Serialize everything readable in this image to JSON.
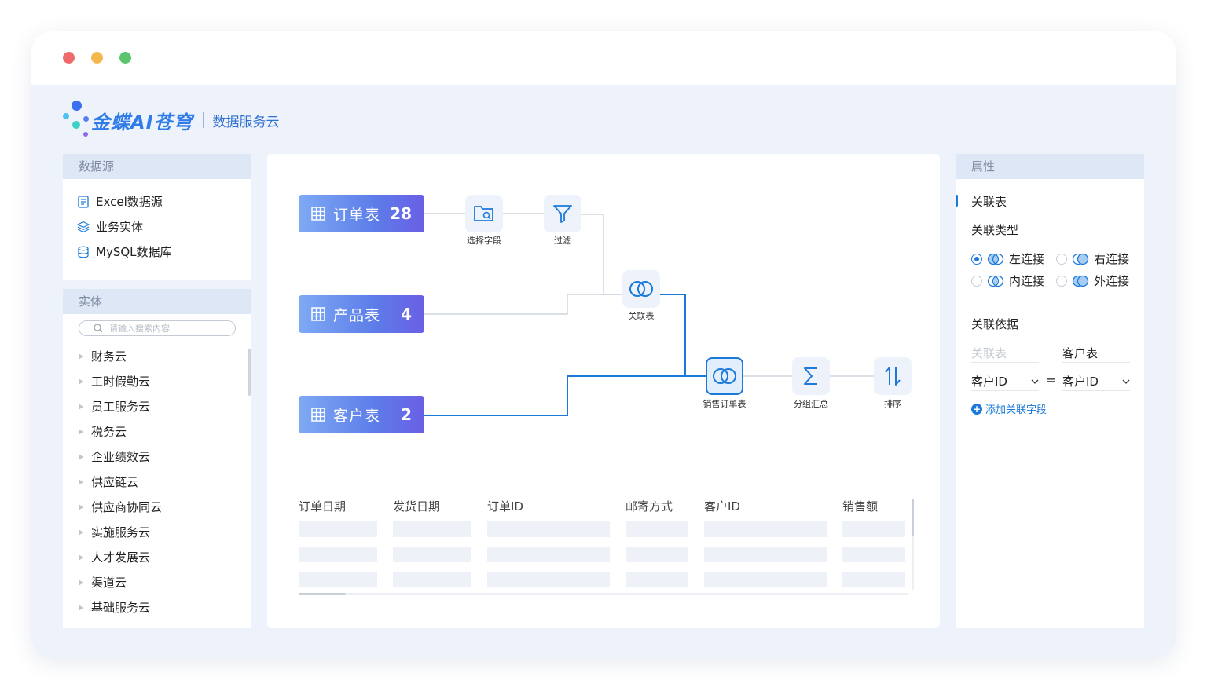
{
  "brand": {
    "name": "金蝶AI苍穹",
    "product": "数据服务云"
  },
  "datasource": {
    "title": "数据源",
    "items": [
      {
        "label": "Excel数据源",
        "icon": "excel-file-icon"
      },
      {
        "label": "业务实体",
        "icon": "layers-icon"
      },
      {
        "label": "MySQL数据库",
        "icon": "database-icon"
      }
    ]
  },
  "entity": {
    "title": "实体",
    "search_placeholder": "请输入搜索内容",
    "items": [
      "财务云",
      "工时假勤云",
      "员工服务云",
      "税务云",
      "企业绩效云",
      "供应链云",
      "供应商协同云",
      "实施服务云",
      "人才发展云",
      "渠道云",
      "基础服务云"
    ]
  },
  "canvas": {
    "sources": [
      {
        "name": "订单表",
        "count": "28"
      },
      {
        "name": "产品表",
        "count": "4"
      },
      {
        "name": "客户表",
        "count": "2"
      }
    ],
    "nodes": {
      "select_fields": "选择字段",
      "filter": "过滤",
      "join": "关联表",
      "sales_order": "销售订单表",
      "group_sum": "分组汇总",
      "sort": "排序"
    },
    "table": {
      "columns": [
        "订单日期",
        "发货日期",
        "订单ID",
        "邮寄方式",
        "客户ID",
        "销售额"
      ]
    }
  },
  "properties": {
    "title": "属性",
    "tab": "关联表",
    "join_type_title": "关联类型",
    "join_types": [
      {
        "label": "左连接",
        "selected": true
      },
      {
        "label": "右连接",
        "selected": false
      },
      {
        "label": "内连接",
        "selected": false
      },
      {
        "label": "外连接",
        "selected": false
      }
    ],
    "join_basis_title": "关联依据",
    "left_header": "关联表",
    "right_header": "客户表",
    "left_field": "客户ID",
    "equals": "=",
    "right_field": "客户ID",
    "add_field": "添加关联字段"
  },
  "colors": {
    "accent": "#1b7ad9",
    "panel_head": "#dde7f6",
    "app_bg": "#eef3fb"
  }
}
